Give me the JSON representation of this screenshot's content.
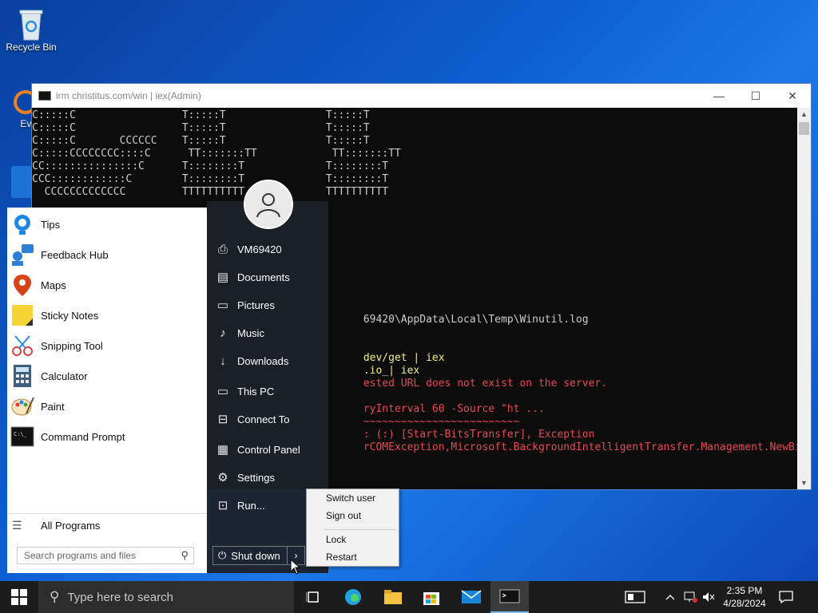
{
  "desktop": {
    "icons": [
      {
        "label": "Recycle Bin"
      },
      {
        "label": "Every"
      }
    ]
  },
  "console": {
    "title": "irm christitus.com/win | iex(Admin)",
    "controls": {
      "minimize": "—",
      "maximize": "☐",
      "close": "✕"
    },
    "lines": [
      {
        "text": "C:::::C                 T:::::T                T:::::T",
        "cls": ""
      },
      {
        "text": "C:::::C                 T:::::T                T:::::T",
        "cls": ""
      },
      {
        "text": "C:::::C       CCCCCC    T:::::T                T:::::T",
        "cls": ""
      },
      {
        "text": "C:::::CCCCCCCC::::C      TT:::::::TT            TT:::::::TT",
        "cls": ""
      },
      {
        "text": "CC:::::::::::::::C      T::::::::T             T::::::::T",
        "cls": ""
      },
      {
        "text": "CCC::::::::::::C        T::::::::T             T::::::::T",
        "cls": ""
      },
      {
        "text": "  CCCCCCCCCCCCC         TTTTTTTTTT             TTTTTTTTTT",
        "cls": ""
      },
      {
        "text": "",
        "cls": ""
      },
      {
        "text": "",
        "cls": ""
      },
      {
        "text": "",
        "cls": ""
      },
      {
        "text": "",
        "cls": ""
      },
      {
        "text": "",
        "cls": ""
      },
      {
        "text": "",
        "cls": ""
      },
      {
        "text": "",
        "cls": ""
      },
      {
        "text": "",
        "cls": ""
      },
      {
        "text": "",
        "cls": ""
      },
      {
        "text": "                                                     69420\\AppData\\Local\\Temp\\Winutil.log",
        "cls": ""
      },
      {
        "text": "",
        "cls": ""
      },
      {
        "text": "",
        "cls": ""
      },
      {
        "text": "                                                     dev/get | iex",
        "cls": "y"
      },
      {
        "text": "                                                     .io_| iex",
        "cls": "y"
      },
      {
        "text": "                                                     ested URL does not exist on the server.",
        "cls": "r"
      },
      {
        "text": "",
        "cls": ""
      },
      {
        "text": "                                                     ryInterval 60 -Source \"ht ...",
        "cls": "r"
      },
      {
        "text": "                                                     ~~~~~~~~~~~~~~~~~~~~~~~~~",
        "cls": "r"
      },
      {
        "text": "                                                     : (:) [Start-BitsTransfer], Exception",
        "cls": "r"
      },
      {
        "text": "                                                     rCOMException,Microsoft.BackgroundIntelligentTransfer.Management.NewBits",
        "cls": "r"
      }
    ]
  },
  "start_menu": {
    "programs": [
      {
        "label": "Tips",
        "icon": "tips-icon"
      },
      {
        "label": "Feedback Hub",
        "icon": "feedback-hub-icon"
      },
      {
        "label": "Maps",
        "icon": "maps-icon"
      },
      {
        "label": "Sticky Notes",
        "icon": "sticky-notes-icon"
      },
      {
        "label": "Snipping Tool",
        "icon": "snipping-tool-icon"
      },
      {
        "label": "Calculator",
        "icon": "calculator-icon"
      },
      {
        "label": "Paint",
        "icon": "paint-icon"
      },
      {
        "label": "Command Prompt",
        "icon": "command-prompt-icon"
      }
    ],
    "all_programs": "All Programs",
    "search_placeholder": "Search programs and files",
    "right_items": [
      {
        "label": "VM69420",
        "icon": "user-folder-icon"
      },
      {
        "label": "Documents",
        "icon": "documents-icon"
      },
      {
        "label": "Pictures",
        "icon": "pictures-icon"
      },
      {
        "label": "Music",
        "icon": "music-icon"
      },
      {
        "label": "Downloads",
        "icon": "downloads-icon"
      },
      {
        "label": "This PC",
        "icon": "this-pc-icon"
      },
      {
        "label": "Connect To",
        "icon": "connect-to-icon"
      },
      {
        "label": "Control Panel",
        "icon": "control-panel-icon"
      },
      {
        "label": "Settings",
        "icon": "settings-icon"
      },
      {
        "label": "Run...",
        "icon": "run-icon"
      }
    ],
    "shutdown_label": "Shut down"
  },
  "power_menu": {
    "items": [
      "Switch user",
      "Sign out",
      "Lock",
      "Restart"
    ]
  },
  "taskbar": {
    "search_placeholder": "Type here to search",
    "time": "2:35 PM",
    "date": "4/28/2024",
    "accent": "#76b9ed"
  }
}
